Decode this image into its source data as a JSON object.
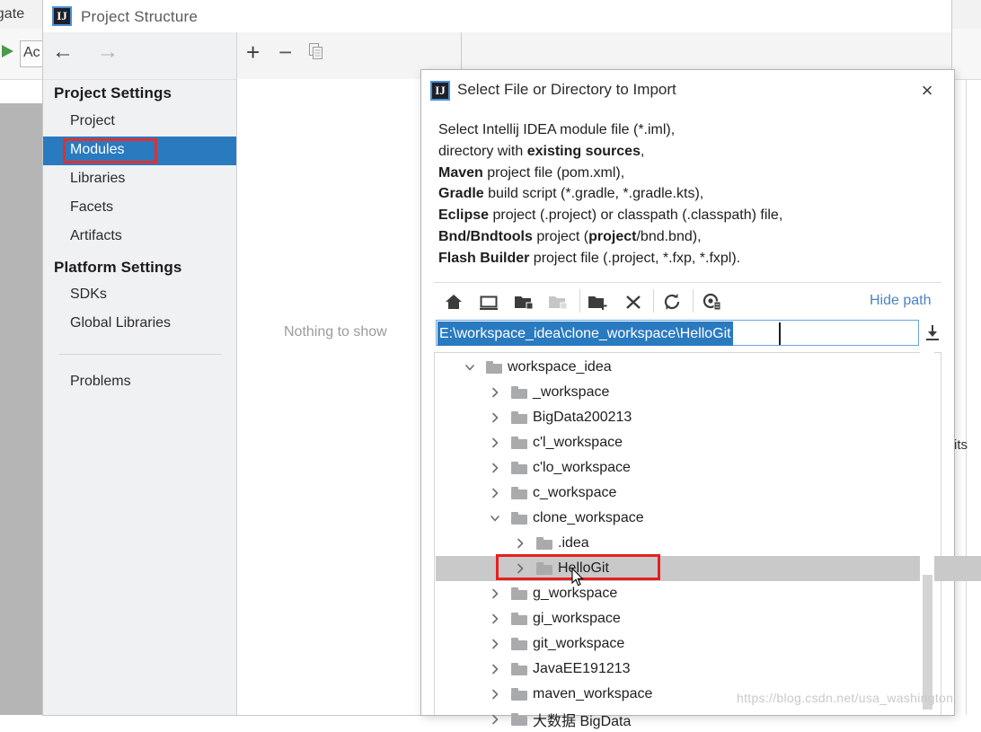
{
  "ide": {
    "menu_navigate": "vigate",
    "action_button": "Ac",
    "right_edge_text": "its"
  },
  "project_structure": {
    "title": "Project Structure",
    "app_icon": "intellij-idea-icon",
    "nav_back_icon": "arrow-left-icon",
    "nav_forward_icon": "arrow-right-icon",
    "sections": [
      {
        "heading": "Project Settings",
        "items": [
          "Project",
          "Modules",
          "Libraries",
          "Facets",
          "Artifacts"
        ]
      },
      {
        "heading": "Platform Settings",
        "items": [
          "SDKs",
          "Global Libraries"
        ]
      }
    ],
    "selected_item": "Modules",
    "problems_item": "Problems",
    "detail_toolbar": {
      "add_label": "+",
      "remove_label": "−",
      "copy_icon": "copy-icon"
    },
    "empty_message": "Nothing to show"
  },
  "dialog": {
    "title": "Select File or Directory to Import",
    "icon": "intellij-idea-icon",
    "close_label": "×",
    "description": [
      [
        {
          "t": "Select Intellij IDEA module file (*.iml),",
          "b": false
        }
      ],
      [
        {
          "t": "directory with ",
          "b": false
        },
        {
          "t": "existing sources",
          "b": true
        },
        {
          "t": ",",
          "b": false
        }
      ],
      [
        {
          "t": "Maven",
          "b": true
        },
        {
          "t": " project file (pom.xml),",
          "b": false
        }
      ],
      [
        {
          "t": "Gradle",
          "b": true
        },
        {
          "t": " build script (*.gradle, *.gradle.kts),",
          "b": false
        }
      ],
      [
        {
          "t": "Eclipse",
          "b": true
        },
        {
          "t": " project (.project) or classpath (.classpath) file,",
          "b": false
        }
      ],
      [
        {
          "t": "Bnd/Bndtools",
          "b": true
        },
        {
          "t": " project (",
          "b": false
        },
        {
          "t": "project",
          "b": true
        },
        {
          "t": "/bnd.bnd),",
          "b": false
        }
      ],
      [
        {
          "t": "Flash Builder",
          "b": true
        },
        {
          "t": " project file (.project, *.fxp, *.fxpl).",
          "b": false
        }
      ]
    ],
    "toolbar_icons": [
      {
        "name": "home-icon",
        "enabled": true
      },
      {
        "name": "desktop-icon",
        "enabled": true
      },
      {
        "name": "expand-folder-icon",
        "enabled": true
      },
      {
        "name": "collapse-folder-icon",
        "enabled": false
      },
      {
        "name": "new-folder-icon",
        "enabled": true
      },
      {
        "name": "delete-icon",
        "enabled": true
      },
      {
        "name": "refresh-icon",
        "enabled": true
      },
      {
        "name": "show-hidden-files-icon",
        "enabled": true
      }
    ],
    "hide_path_label": "Hide path",
    "path_value": "E:\\workspace_idea\\clone_workspace\\HelloGit",
    "path_dropdown_icon": "download-arrow-icon",
    "path_selected": true,
    "tree": [
      {
        "label": "workspace_idea",
        "depth": 0,
        "state": "expanded",
        "selected": false
      },
      {
        "label": "_workspace",
        "depth": 1,
        "state": "collapsed",
        "selected": false
      },
      {
        "label": "BigData200213",
        "depth": 1,
        "state": "collapsed",
        "selected": false
      },
      {
        "label": "c'l_workspace",
        "depth": 1,
        "state": "collapsed",
        "selected": false
      },
      {
        "label": "c'lo_workspace",
        "depth": 1,
        "state": "collapsed",
        "selected": false
      },
      {
        "label": "c_workspace",
        "depth": 1,
        "state": "collapsed",
        "selected": false
      },
      {
        "label": "clone_workspace",
        "depth": 1,
        "state": "expanded",
        "selected": false
      },
      {
        "label": ".idea",
        "depth": 2,
        "state": "collapsed",
        "selected": false
      },
      {
        "label": "HelloGit",
        "depth": 2,
        "state": "collapsed",
        "selected": true
      },
      {
        "label": "g_workspace",
        "depth": 1,
        "state": "collapsed",
        "selected": false
      },
      {
        "label": "gi_workspace",
        "depth": 1,
        "state": "collapsed",
        "selected": false
      },
      {
        "label": "git_workspace",
        "depth": 1,
        "state": "collapsed",
        "selected": false
      },
      {
        "label": "JavaEE191213",
        "depth": 1,
        "state": "collapsed",
        "selected": false
      },
      {
        "label": "maven_workspace",
        "depth": 1,
        "state": "collapsed",
        "selected": false
      },
      {
        "label": "大数据 BigData",
        "depth": 1,
        "state": "collapsed",
        "selected": false
      }
    ]
  },
  "annotations": {
    "modules_box_color": "#e03030",
    "hellogit_box_color": "#e52020"
  },
  "watermark": "https://blog.csdn.net/usa_washington",
  "colors": {
    "selection_blue": "#2a7ac0",
    "link_blue": "#4a84c4",
    "tree_selection_gray": "#c9c9c9",
    "sidebar_bg": "#eff1f3"
  }
}
